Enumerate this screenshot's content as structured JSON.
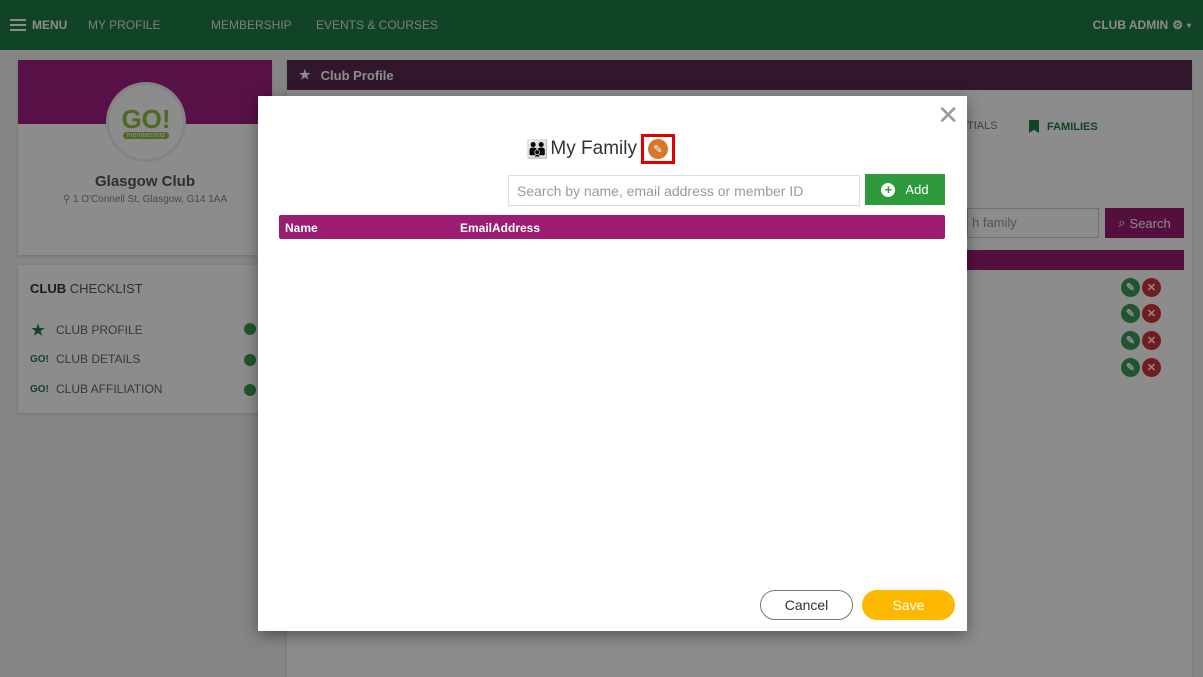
{
  "nav": {
    "menu_label": "MENU",
    "links": [
      "MY PROFILE",
      "MEMBERSHIP",
      "EVENTS & COURSES"
    ],
    "admin_label": "CLUB ADMIN"
  },
  "club": {
    "logo_text": "GO!",
    "logo_sub": "membership",
    "name": "Glasgow Club",
    "address": "1 O'Connell St, Glasgow, G14 1AA"
  },
  "checklist": {
    "title_bold": "CLUB",
    "title_rest": " CHECKLIST",
    "items": [
      {
        "icon": "star-icon",
        "label": "CLUB PROFILE"
      },
      {
        "icon": "go-icon",
        "label": "CLUB DETAILS"
      },
      {
        "icon": "go-icon",
        "label": "CLUB AFFILIATION"
      }
    ]
  },
  "main": {
    "header_title": "Club Profile",
    "tab_partial": "TIALS",
    "tab_families": "FAMILIES",
    "search_partial": "h family",
    "search_button": "Search"
  },
  "modal": {
    "title": "My Family",
    "search_placeholder": "Search by name, email address or member ID",
    "add_label": "Add",
    "columns": [
      "Name",
      "EmailAddress"
    ],
    "rows": [],
    "cancel_label": "Cancel",
    "save_label": "Save"
  },
  "colors": {
    "nav": "#1f7a45",
    "brand_purple": "#9b1c70",
    "add_green": "#2e9a3c",
    "save_yellow": "#ffb800",
    "edit_orange": "#d8762a",
    "highlight_red": "#e00000"
  }
}
